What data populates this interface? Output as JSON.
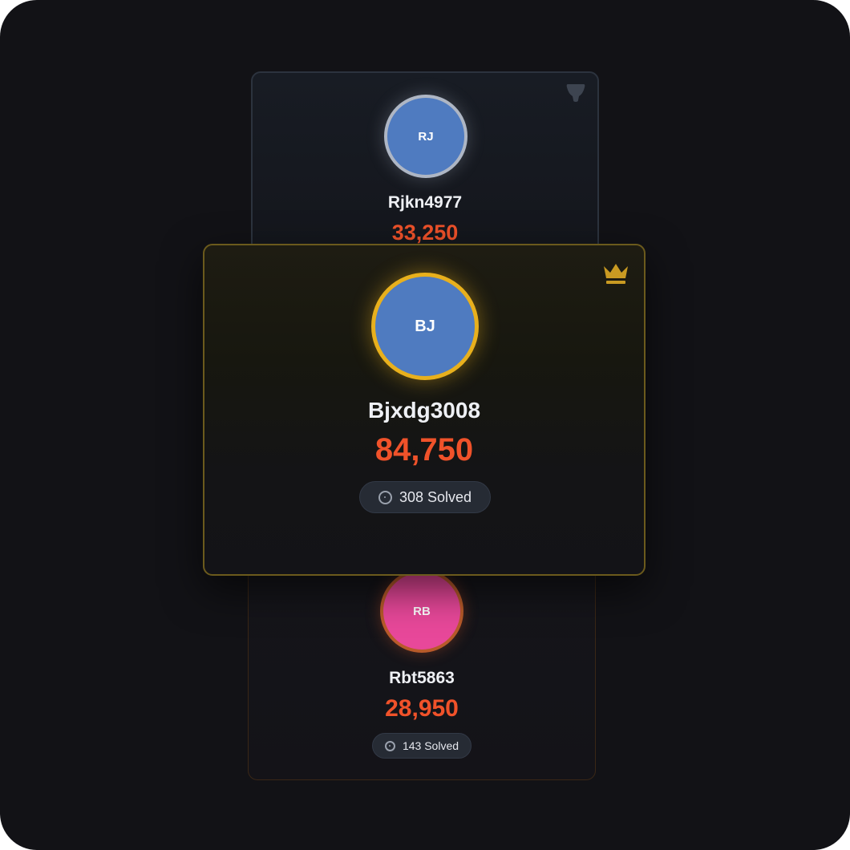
{
  "leaderboard": {
    "first": {
      "initials": "BJ",
      "username": "Bjxdg3008",
      "score": "84,750",
      "solved": "308 Solved",
      "rank_icon": "crown-icon",
      "accent": "#e8b01d"
    },
    "second": {
      "initials": "RJ",
      "username": "Rjkn4977",
      "score": "33,250",
      "rank_icon": "trophy-icon",
      "accent": "#aeb6c4"
    },
    "third": {
      "initials": "RB",
      "username": "Rbt5863",
      "score": "28,950",
      "solved": "143 Solved",
      "accent": "#b85a2a"
    }
  },
  "colors": {
    "background": "#121216",
    "score": "#f0522a",
    "avatar_blue": "#4f7bc0",
    "avatar_pink": "#e8489a"
  }
}
